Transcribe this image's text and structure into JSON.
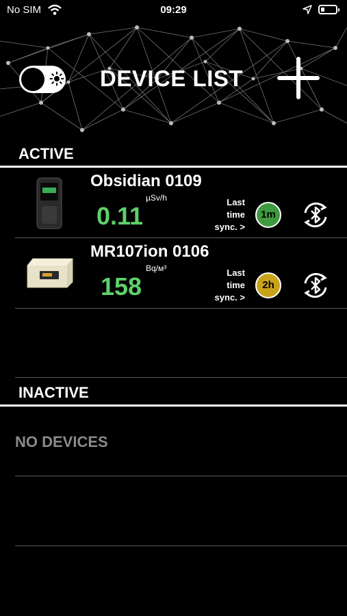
{
  "status_bar": {
    "carrier": "No SIM",
    "time": "09:29"
  },
  "header": {
    "title": "DEVICE LIST"
  },
  "active": {
    "title": "ACTIVE",
    "devices": [
      {
        "name": "Obsidian 0109",
        "value": "0.11",
        "unit": "µSv/h",
        "sync_label_1": "Last",
        "sync_label_2": "time",
        "sync_label_3": "sync. >",
        "sync_age": "1m",
        "sync_color": "#3f9a3f",
        "sync_progress": 0.25
      },
      {
        "name": "MR107ion 0106",
        "value": "158",
        "unit": "Bq/м³",
        "sync_label_1": "Last",
        "sync_label_2": "time",
        "sync_label_3": "sync. >",
        "sync_age": "2h",
        "sync_color": "#c9a21a",
        "sync_progress": 1.0
      }
    ]
  },
  "inactive": {
    "title": "INACTIVE",
    "empty_text": "NO DEVICES"
  },
  "colors": {
    "value_green": "#5fd06a",
    "background": "#000000"
  }
}
